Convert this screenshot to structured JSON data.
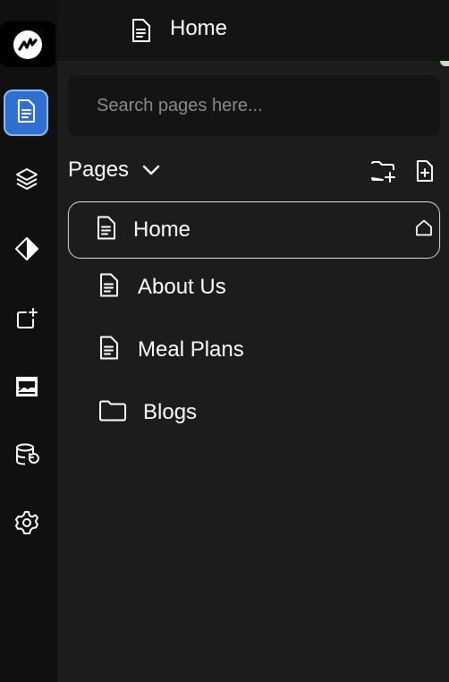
{
  "header": {
    "title": "Home",
    "title_icon": "document-icon"
  },
  "sidebar": {
    "logo_icon": "app-logo-icon",
    "items": [
      {
        "name": "pages",
        "icon": "document-icon",
        "active": true
      },
      {
        "name": "layers",
        "icon": "layers-icon",
        "active": false
      },
      {
        "name": "components",
        "icon": "diamond-icon",
        "active": false
      },
      {
        "name": "add-element",
        "icon": "add-element-icon",
        "active": false
      },
      {
        "name": "analytics",
        "icon": "chart-icon",
        "active": false
      },
      {
        "name": "database",
        "icon": "database-icon",
        "active": false
      },
      {
        "name": "settings",
        "icon": "gear-icon",
        "active": false
      }
    ]
  },
  "search": {
    "placeholder": "Search pages here...",
    "value": ""
  },
  "pages_panel": {
    "heading": "Pages",
    "actions": [
      "new-folder-icon",
      "new-page-icon"
    ],
    "items": [
      {
        "label": "Home",
        "type": "page",
        "selected": true,
        "is_home": true
      },
      {
        "label": "About Us",
        "type": "page",
        "selected": false
      },
      {
        "label": "Meal Plans",
        "type": "page",
        "selected": false
      },
      {
        "label": "Blogs",
        "type": "folder",
        "selected": false
      }
    ]
  },
  "colors": {
    "accent": "#2f6fcf",
    "background": "#1c1c1c",
    "rail": "#101010"
  }
}
